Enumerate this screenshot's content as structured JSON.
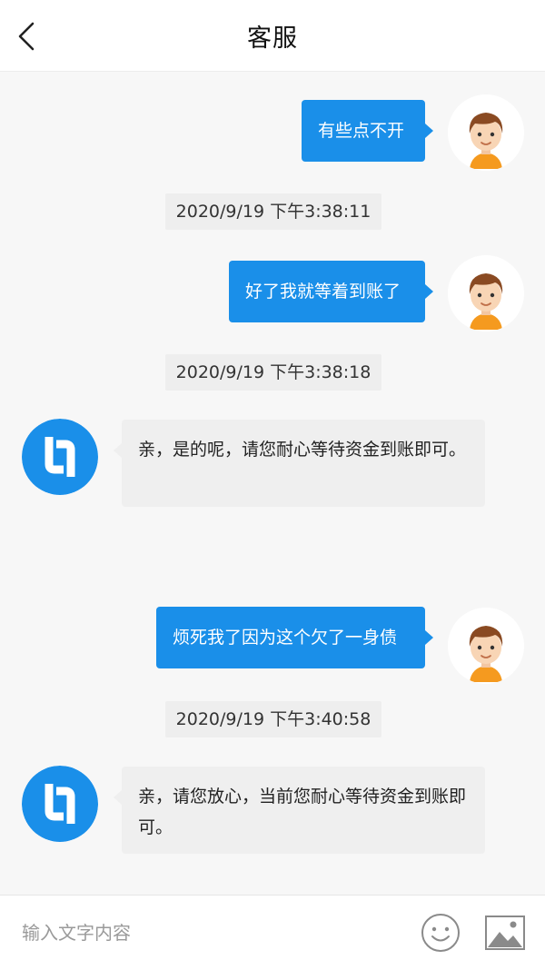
{
  "header": {
    "title": "客服",
    "back_icon": "chevron-left-icon"
  },
  "messages": [
    {
      "side": "out",
      "text": "有些点不开"
    },
    {
      "timestamp": "2020/9/19 下午3:38:11"
    },
    {
      "side": "out",
      "text": "好了我就等着到账了"
    },
    {
      "timestamp": "2020/9/19 下午3:38:18"
    },
    {
      "side": "in",
      "text": "亲，是的呢，请您耐心等待资金到账即可。"
    },
    {
      "side": "out",
      "text": "烦死我了因为这个欠了一身债"
    },
    {
      "timestamp": "2020/9/19 下午3:40:58"
    },
    {
      "side": "in",
      "text": "亲，请您放心，当前您耐心等待资金到账即可。"
    }
  ],
  "input": {
    "placeholder": "输入文字内容",
    "value": ""
  },
  "colors": {
    "accent": "#1a8fe9",
    "bubble_in": "#efefef",
    "background": "#f7f7f7"
  },
  "icons": {
    "emoji": "smiley-face-icon",
    "image": "image-picture-icon"
  }
}
